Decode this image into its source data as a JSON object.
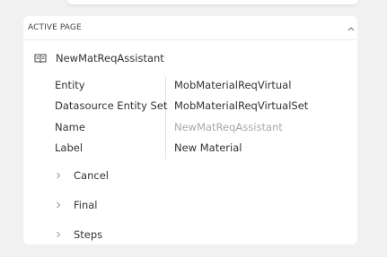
{
  "panel": {
    "title": "ACTIVE PAGE",
    "page_name": "NewMatReqAssistant"
  },
  "properties": [
    {
      "key": "Entity",
      "value": "MobMaterialReqVirtual"
    },
    {
      "key": "Datasource Entity Set",
      "value": "MobMaterialReqVirtualSet"
    },
    {
      "key": "Name",
      "value": "NewMatReqAssistant"
    },
    {
      "key": "Label",
      "value": "New Material"
    }
  ],
  "tree_items": [
    {
      "label": "Cancel"
    },
    {
      "label": "Final"
    },
    {
      "label": "Steps"
    }
  ],
  "colors": {
    "background": "#f1f1f1",
    "panel": "#ffffff",
    "text": "#333333",
    "muted_value": "#a9a9a9"
  },
  "icons": {
    "collapse": "chevron-up-icon",
    "page": "book-open-icon",
    "tree_expand": "chevron-right-icon"
  }
}
